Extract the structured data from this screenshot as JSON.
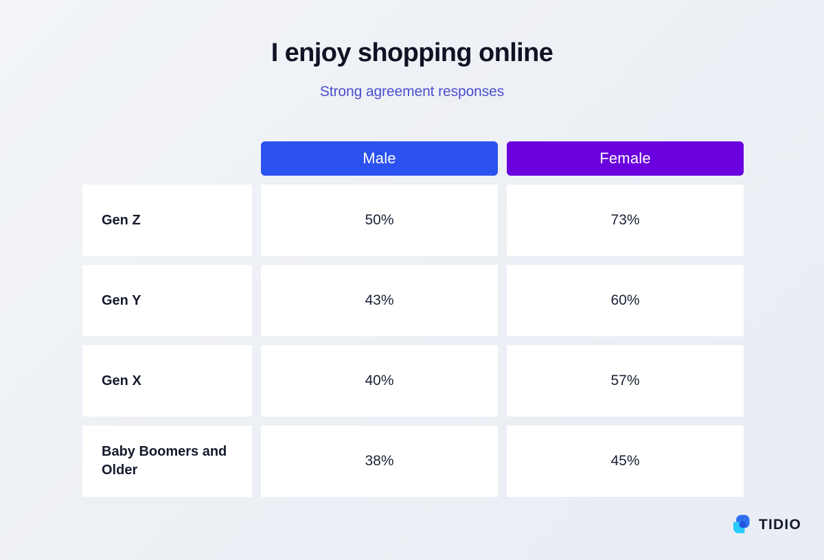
{
  "header": {
    "title": "I enjoy shopping online",
    "subtitle": "Strong agreement responses"
  },
  "colors": {
    "background": "#edf0f5",
    "male_header": "#2b51ee",
    "female_header": "#6a00dd",
    "title": "#0f1424",
    "subtitle": "#4a4ecb",
    "cell_background": "#ffffff",
    "cell_text": "#1b2134",
    "logo_blue": "#2f6fed",
    "logo_cyan": "#2bcbfa"
  },
  "table": {
    "corner_label": "",
    "columns": [
      {
        "label": "Male",
        "accent": "#2b51ee"
      },
      {
        "label": "Female",
        "accent": "#6a00dd"
      }
    ],
    "rows": [
      {
        "label": "Gen Z",
        "values": [
          "50%",
          "73%"
        ]
      },
      {
        "label": "Gen Y",
        "values": [
          "43%",
          "60%"
        ]
      },
      {
        "label": "Gen X",
        "values": [
          "40%",
          "57%"
        ]
      },
      {
        "label": "Baby Boomers and Older",
        "values": [
          "38%",
          "45%"
        ]
      }
    ]
  },
  "logo": {
    "wordmark": "TIDIO",
    "mark_name": "tidio-chat-bubbles-icon"
  },
  "chart_data": {
    "type": "table",
    "title": "I enjoy shopping online",
    "subtitle": "Strong agreement responses",
    "xlabel": "",
    "ylabel": "",
    "categories": [
      "Gen Z",
      "Gen Y",
      "Gen X",
      "Baby Boomers and Older"
    ],
    "series": [
      {
        "name": "Male",
        "values": [
          50,
          43,
          40,
          38
        ],
        "color": "#2b51ee"
      },
      {
        "name": "Female",
        "values": [
          73,
          60,
          57,
          45
        ],
        "color": "#6a00dd"
      }
    ],
    "unit": "percent",
    "ylim": [
      0,
      100
    ],
    "grid": false,
    "legend": "column-headers"
  }
}
